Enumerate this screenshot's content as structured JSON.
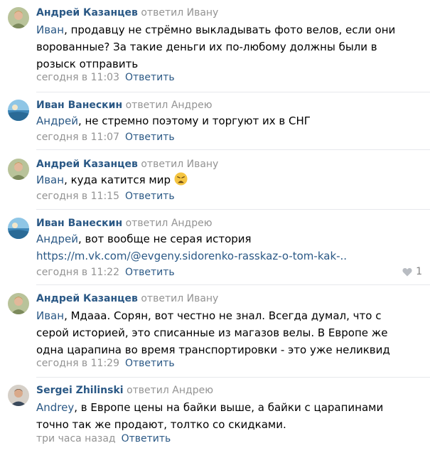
{
  "comments": [
    {
      "author": "Андрей Казанцев",
      "replied_to": "ответил Ивану",
      "mention": "Иван",
      "text": ", продавцу не стрёмно выкладывать фото велов, если они ворованные? За такие деньги их по-любому должны были в розыск отправить",
      "time": "сегодня в 11:03",
      "reply_label": "Ответить",
      "avatar": "avatar-photo"
    },
    {
      "author": "Иван Ванескин",
      "replied_to": "ответил Андрею",
      "mention": "Андрей",
      "text": ", не стремно поэтому и торгуют их в СНГ",
      "time": "сегодня в 11:07",
      "reply_label": "Ответить",
      "avatar": "avatar-photo"
    },
    {
      "author": "Андрей Казанцев",
      "replied_to": "ответил Ивану",
      "mention": "Иван",
      "text": ", куда катится мир",
      "emoji": "weary-face-emoji",
      "time": "сегодня в 11:15",
      "reply_label": "Ответить",
      "avatar": "avatar-photo"
    },
    {
      "author": "Иван Ванескин",
      "replied_to": "ответил Андрею",
      "mention": "Андрей",
      "text": ", вот вообще не серая история",
      "link": "https://m.vk.com/@evgeny.sidorenko-rasskaz-o-tom-kak-..",
      "time": "сегодня в 11:22",
      "reply_label": "Ответить",
      "likes": "1",
      "like_icon": "heart-icon",
      "avatar": "avatar-photo"
    },
    {
      "author": "Андрей Казанцев",
      "replied_to": "ответил Ивану",
      "mention": "Иван",
      "text": ", Мдааа. Сорян, вот честно не знал. Всегда думал, что с серой историей, это списанные из магазов велы. В Европе же одна царапина во время транспортировки - это уже неликвид",
      "time": "сегодня в 11:29",
      "reply_label": "Ответить",
      "avatar": "avatar-photo"
    },
    {
      "author": "Sergei Zhilinski",
      "replied_to": "ответил Андрею",
      "mention": "Andrey",
      "text": ", в Европе цены на байки выше, а байки с царапинами точно так же продают, толтко со скидками.",
      "time": "три часа назад",
      "reply_label": "Ответить",
      "avatar": "avatar-photo"
    }
  ]
}
